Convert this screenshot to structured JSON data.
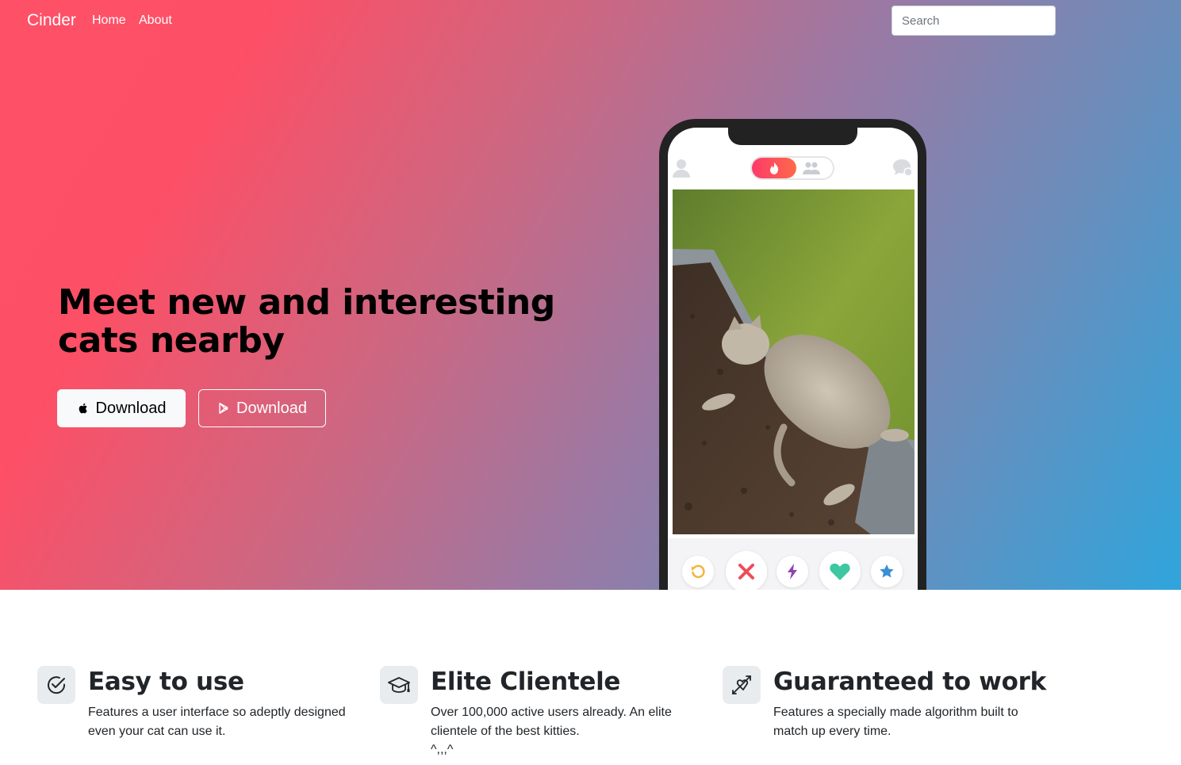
{
  "navbar": {
    "brand": "Cinder",
    "links": [
      "Home",
      "About"
    ],
    "search_placeholder": "Search"
  },
  "hero": {
    "headline": "Meet new and interesting cats nearby",
    "download_apple_label": "Download",
    "download_play_label": "Download"
  },
  "phone": {
    "actions": [
      "rewind-icon",
      "nope-icon",
      "boost-icon",
      "like-icon",
      "super-like-icon"
    ],
    "colors": {
      "rewind": "#f5b43b",
      "nope": "#ee4c59",
      "boost": "#8e44ad",
      "like": "#3ec7a2",
      "super_like": "#3a8fd6"
    }
  },
  "features": [
    {
      "title": "Easy to use",
      "text": "Features a user interface so adeptly designed even your cat can use it.",
      "icon": "check-circle-icon"
    },
    {
      "title": "Elite Clientele",
      "text": "Over 100,000 active users already. An elite clientele of the best kitties.",
      "extra": "^,,,^",
      "icon": "graduation-cap-icon"
    },
    {
      "title": "Guaranteed to work",
      "text": "Features a specially made algorithm built to match up every time.",
      "icon": "heart-arrow-icon"
    }
  ],
  "colors": {
    "gradient_start": "#fe5167",
    "gradient_end": "#2fa5dc"
  }
}
